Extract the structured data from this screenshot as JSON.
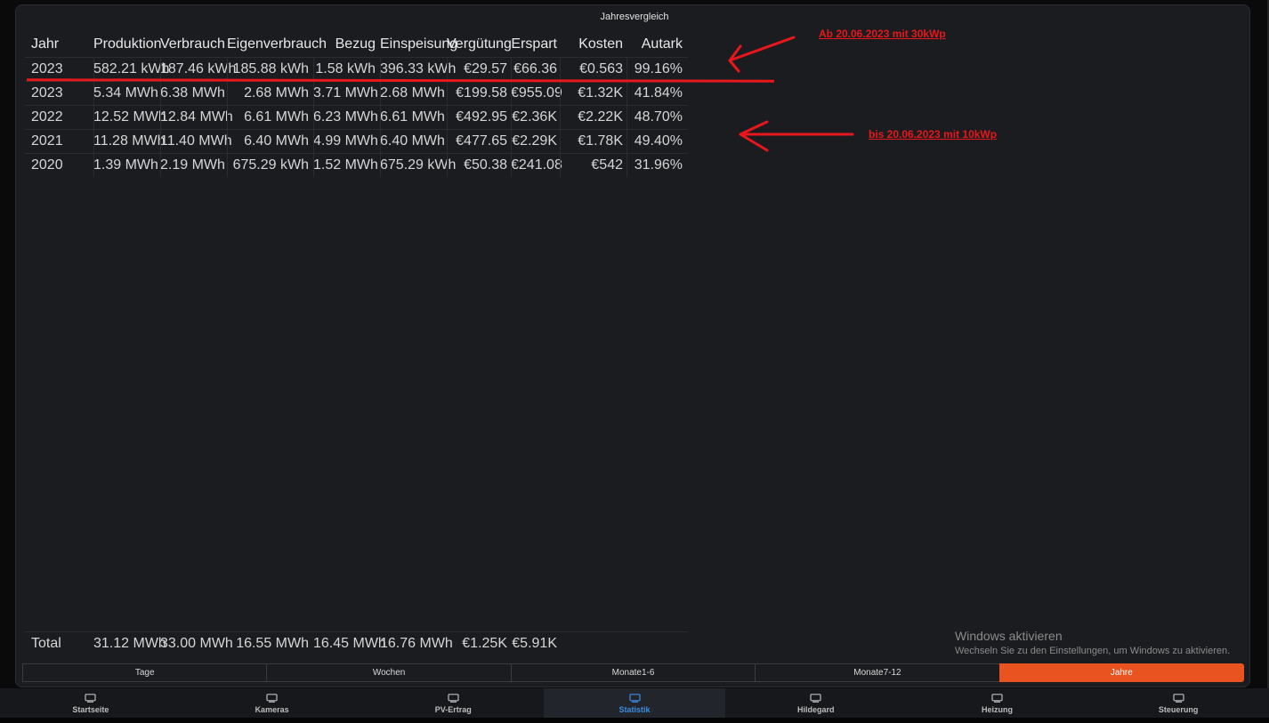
{
  "title": "Jahresvergleich",
  "columns": [
    "Jahr",
    "Produktion",
    "Verbrauch",
    "Eigenverbrauch",
    "Bezug",
    "Einspeisung",
    "Vergütung",
    "Erspart",
    "Kosten",
    "Autark"
  ],
  "rows": [
    [
      "2023",
      "582.21 kWh",
      "187.46 kWh",
      "185.88 kWh",
      "1.58 kWh",
      "396.33 kWh",
      "€29.57",
      "€66.36",
      "€0.563",
      "99.16%"
    ],
    [
      "2023",
      "5.34 MWh",
      "6.38 MWh",
      "2.68 MWh",
      "3.71 MWh",
      "2.68 MWh",
      "€199.58",
      "€955.09",
      "€1.32K",
      "41.84%"
    ],
    [
      "2022",
      "12.52 MWh",
      "12.84 MWh",
      "6.61 MWh",
      "6.23 MWh",
      "6.61 MWh",
      "€492.95",
      "€2.36K",
      "€2.22K",
      "48.70%"
    ],
    [
      "2021",
      "11.28 MWh",
      "11.40 MWh",
      "6.40 MWh",
      "4.99 MWh",
      "6.40 MWh",
      "€477.65",
      "€2.29K",
      "€1.78K",
      "49.40%"
    ],
    [
      "2020",
      "1.39 MWh",
      "2.19 MWh",
      "675.29 kWh",
      "1.52 MWh",
      "675.29 kWh",
      "€50.38",
      "€241.08",
      "€542",
      "31.96%"
    ]
  ],
  "total": [
    "Total",
    "31.12 MWh",
    "33.00 MWh",
    "16.55 MWh",
    "16.45 MWh",
    "16.76 MWh",
    "€1.25K",
    "€5.91K",
    "",
    ""
  ],
  "annotations": {
    "top": "Ab 20.06.2023 mit 30kWp",
    "bottom": "bis 20.06.2023 mit 10kWp"
  },
  "windows_notice": {
    "title": "Windows aktivieren",
    "subtitle": "Wechseln Sie zu den Einstellungen, um Windows zu aktivieren."
  },
  "tabs": [
    {
      "label": "Tage",
      "active": false
    },
    {
      "label": "Wochen",
      "active": false
    },
    {
      "label": "Monate1-6",
      "active": false
    },
    {
      "label": "Monate7-12",
      "active": false
    },
    {
      "label": "Jahre",
      "active": true
    }
  ],
  "nav": [
    {
      "label": "Startseite",
      "icon": "monitor-icon",
      "active": false
    },
    {
      "label": "Kameras",
      "icon": "monitor-icon",
      "active": false
    },
    {
      "label": "PV-Ertrag",
      "icon": "monitor-icon",
      "active": false
    },
    {
      "label": "Statistik",
      "icon": "monitor-icon",
      "active": true
    },
    {
      "label": "Hildegard",
      "icon": "monitor-icon",
      "active": false
    },
    {
      "label": "Heizung",
      "icon": "monitor-icon",
      "active": false
    },
    {
      "label": "Steuerung",
      "icon": "monitor-icon",
      "active": false
    }
  ],
  "colors": {
    "accent": "#e8531f",
    "active_nav": "#3b8de0",
    "annotation": "#e8171b"
  }
}
